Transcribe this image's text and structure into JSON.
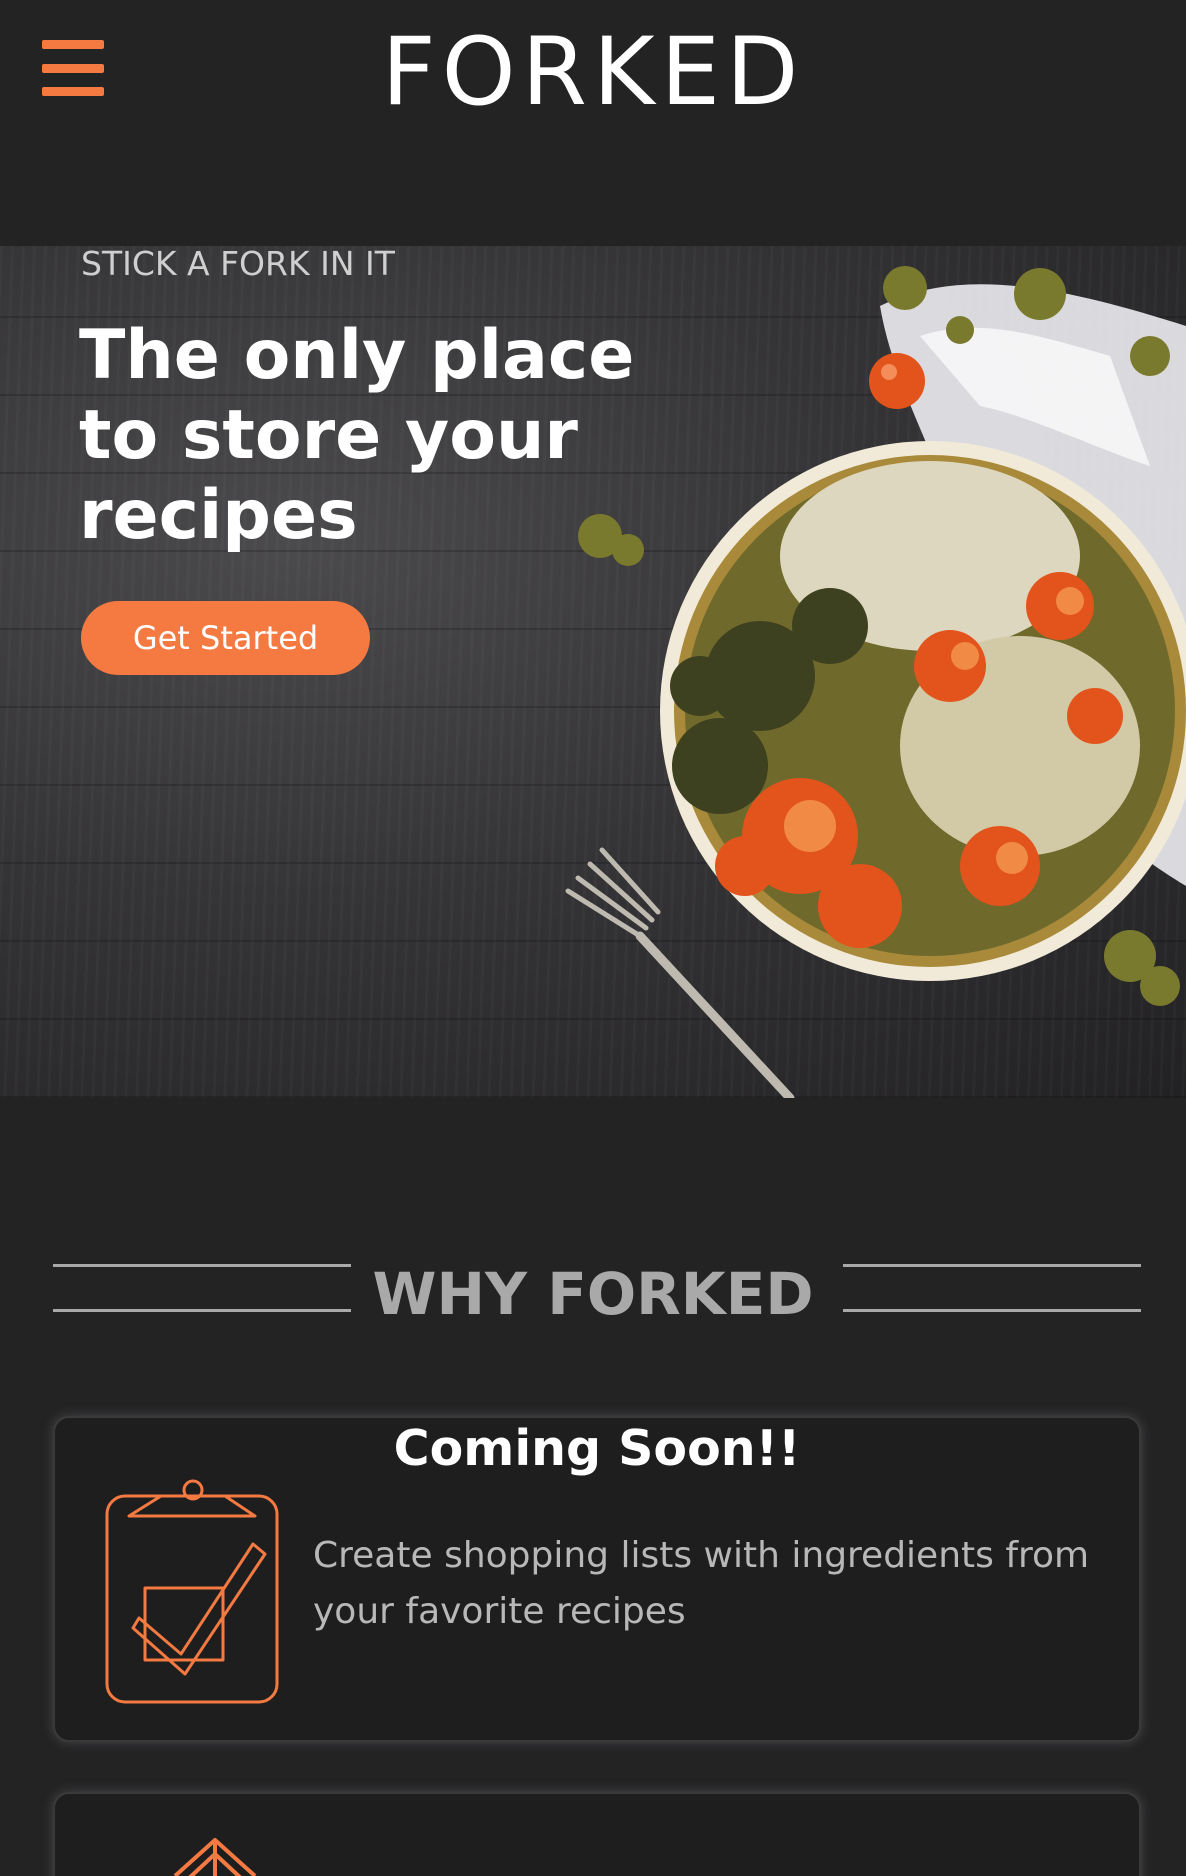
{
  "header": {
    "brand": "FORKED",
    "menu_icon": "hamburger-menu-icon"
  },
  "hero": {
    "kicker": "STICK A FORK IN IT",
    "title_line_1": "The only place",
    "title_line_2": "to store your",
    "title_line_3": "recipes",
    "cta_label": "Get Started"
  },
  "why": {
    "title": "WHY FORKED"
  },
  "features": [
    {
      "heading": "Coming Soon!!",
      "icon": "clipboard-check-icon",
      "description": "Create shopping lists with ingredients from your favorite recipes"
    },
    {
      "icon": "upload-arrow-icon"
    }
  ],
  "colors": {
    "accent": "#f47a42",
    "background": "#232324",
    "muted_text": "#a9a9a9"
  }
}
